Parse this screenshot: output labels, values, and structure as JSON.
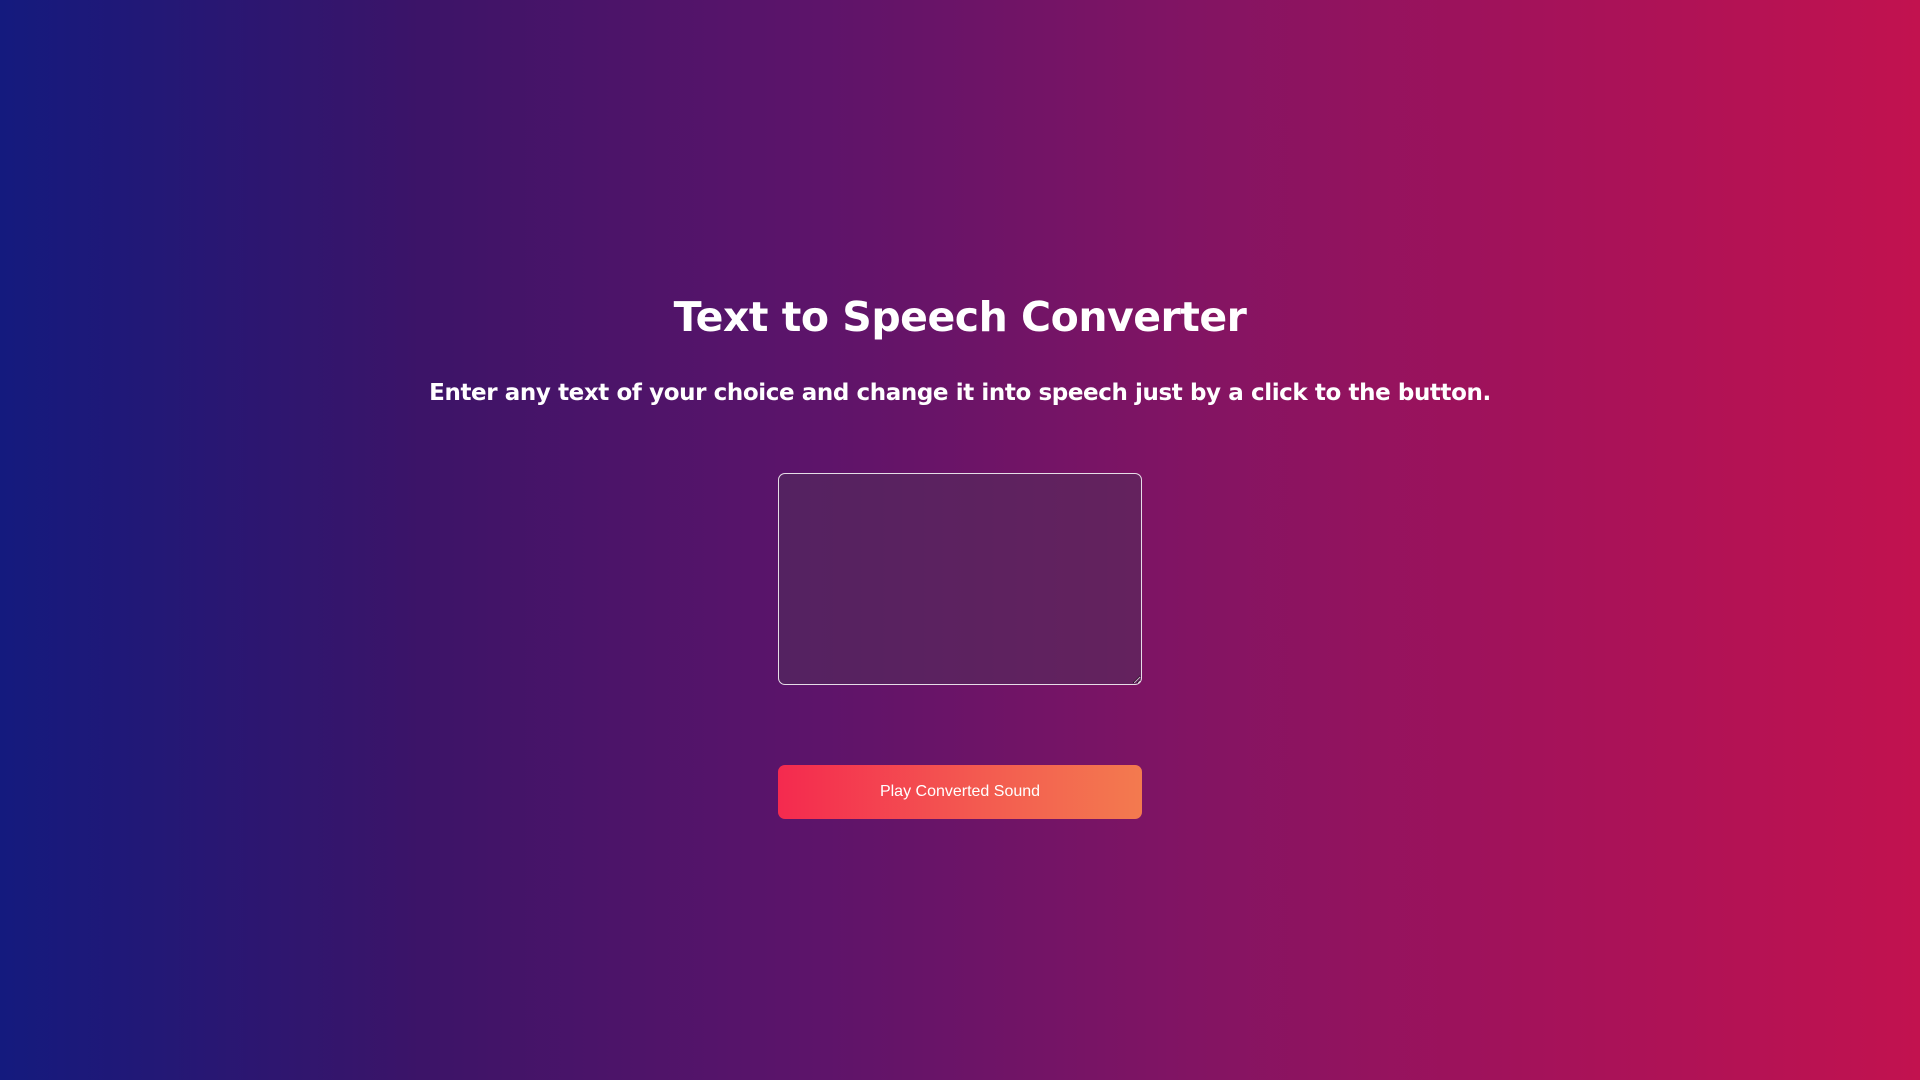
{
  "header": {
    "title": "Text to Speech Converter",
    "subtitle": "Enter any text of your choice and change it into speech just by a click to the button."
  },
  "input": {
    "value": "",
    "placeholder": ""
  },
  "actions": {
    "play_label": "Play Converted Sound"
  },
  "theme": {
    "background_left": "#141a7e",
    "background_right": "#c2124f",
    "button_left": "#f42a4f",
    "button_right": "#f37a4f",
    "text_color": "#ffffff"
  }
}
